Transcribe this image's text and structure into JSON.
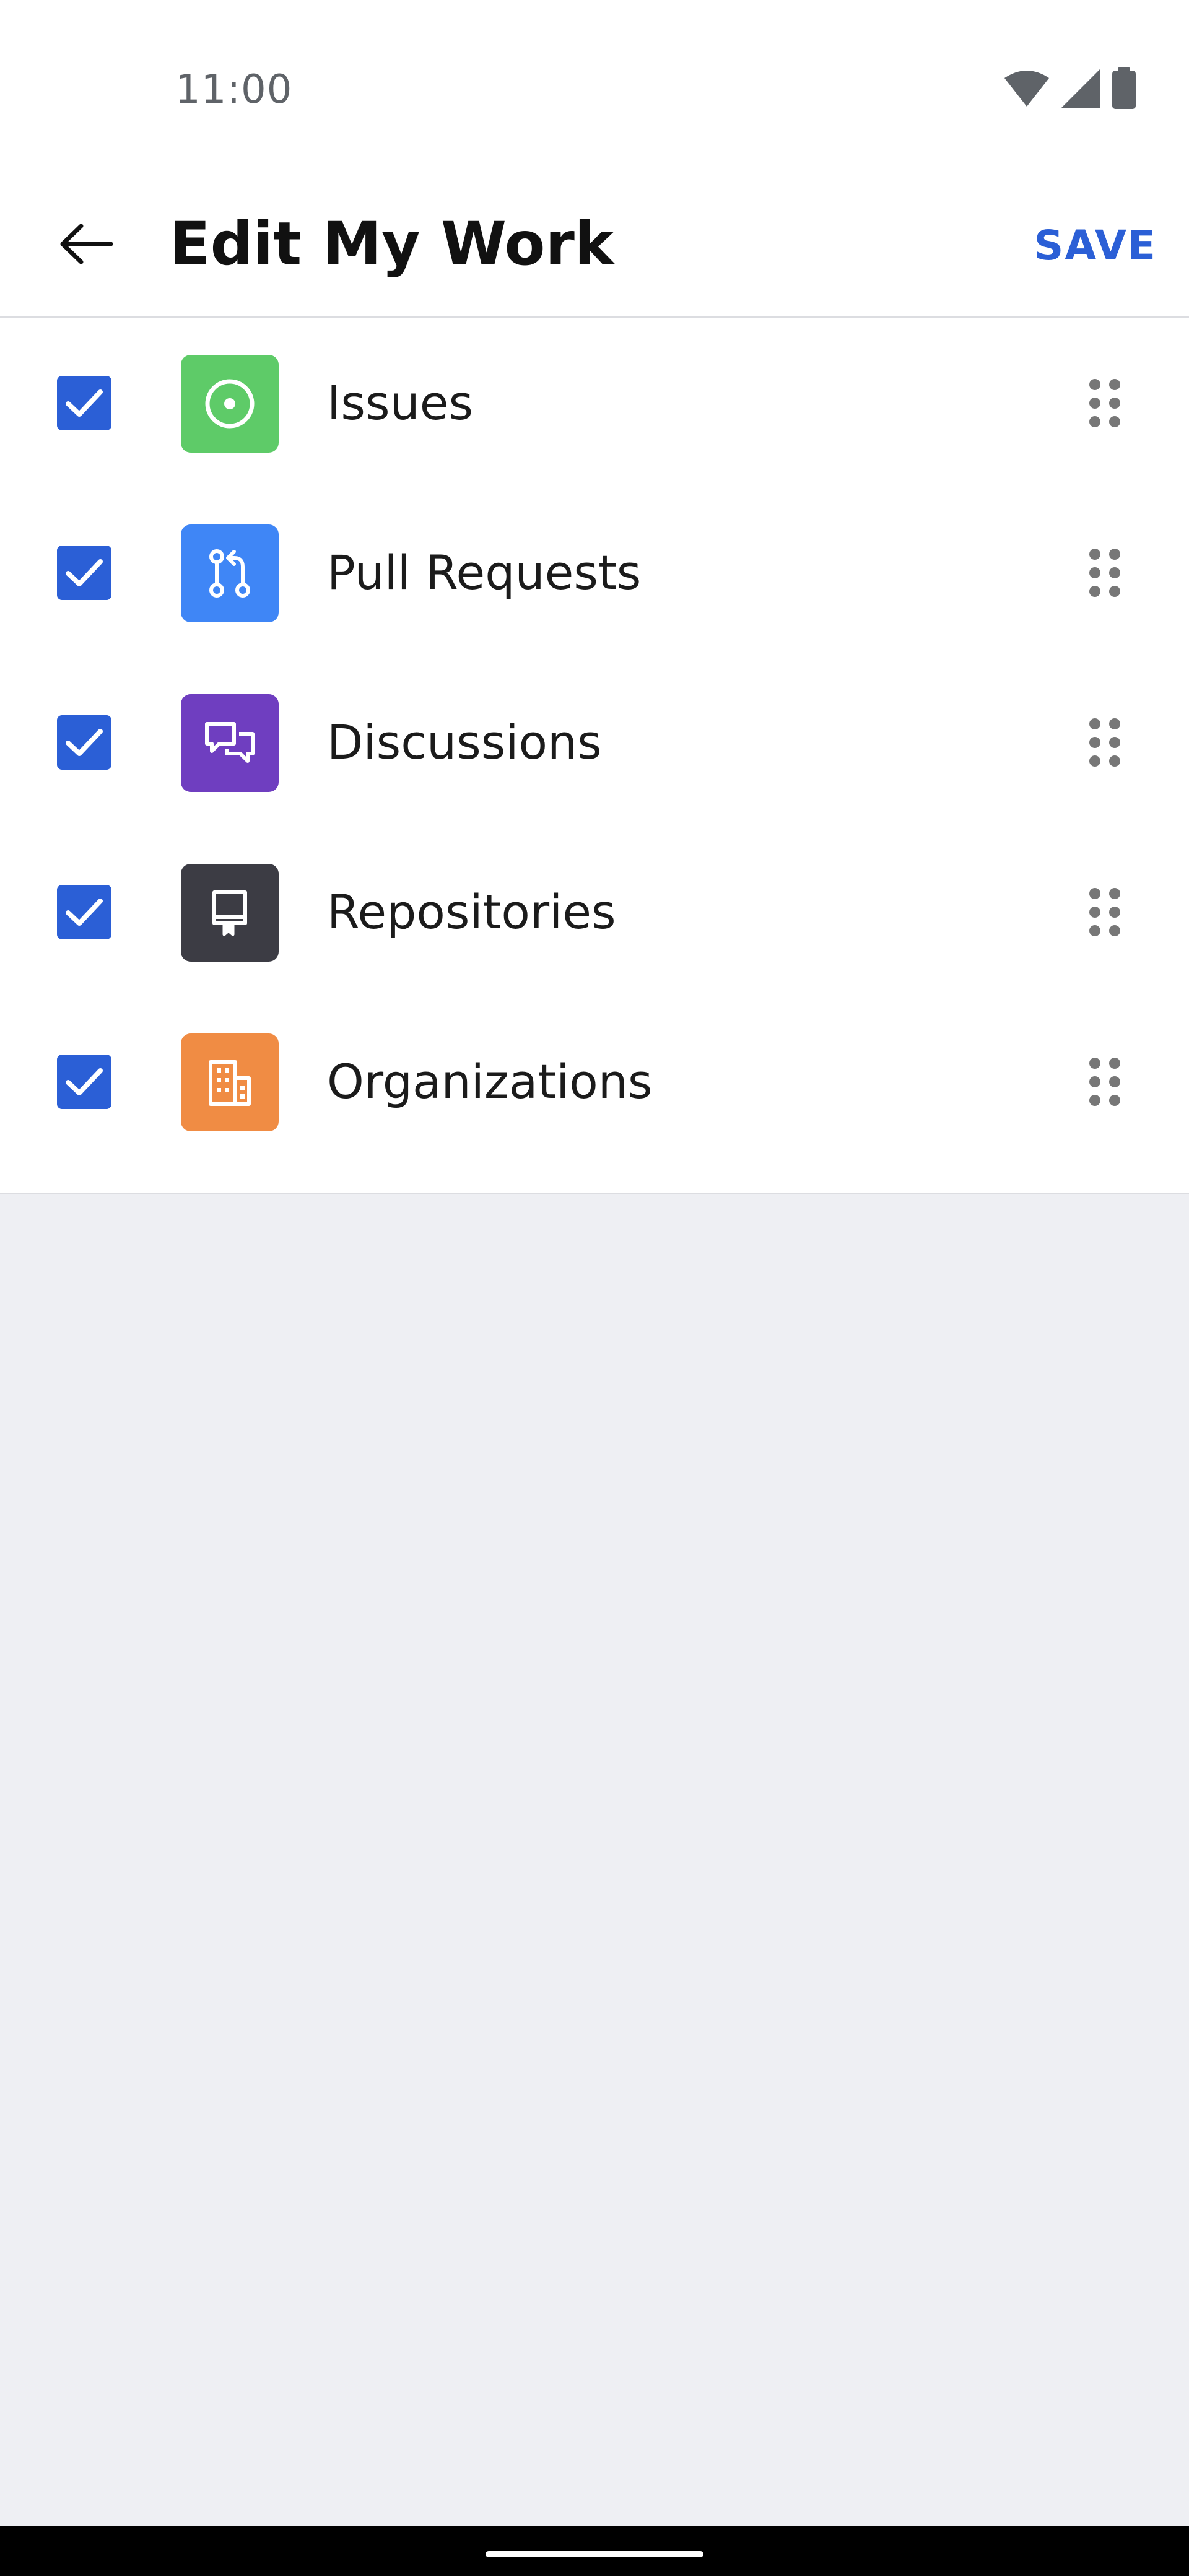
{
  "status_bar": {
    "time": "11:00",
    "icons": [
      "wifi-icon",
      "signal-icon",
      "battery-icon"
    ]
  },
  "app_bar": {
    "back_icon": "arrow-left-icon",
    "title": "Edit My Work",
    "save_label": "SAVE"
  },
  "colors": {
    "accent": "#2b5fd6",
    "issues": "#5ecb68",
    "pull_requests": "#3f86f6",
    "discussions": "#6f3ec0",
    "repositories": "#3c3c44",
    "organizations": "#f08c44",
    "background": "#eeeff3"
  },
  "items": [
    {
      "label": "Issues",
      "checked": true,
      "icon": "issue-opened-icon"
    },
    {
      "label": "Pull Requests",
      "checked": true,
      "icon": "git-pull-request-icon"
    },
    {
      "label": "Discussions",
      "checked": true,
      "icon": "comment-discussion-icon"
    },
    {
      "label": "Repositories",
      "checked": true,
      "icon": "repo-icon"
    },
    {
      "label": "Organizations",
      "checked": true,
      "icon": "organization-icon"
    }
  ]
}
